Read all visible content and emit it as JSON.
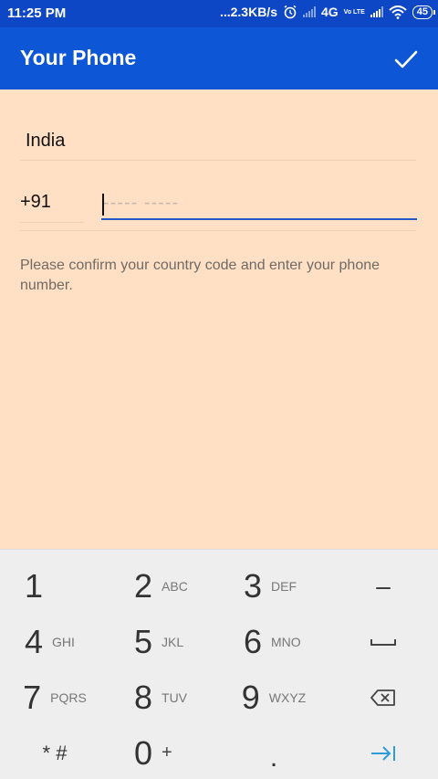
{
  "status_bar": {
    "time": "11:25 PM",
    "speed": "...2.3KB/s",
    "network": "4G",
    "volte": "Vo LTE",
    "battery": "45"
  },
  "app_bar": {
    "title": "Your Phone"
  },
  "form": {
    "country": "India",
    "country_code": "+91",
    "phone_placeholder": "----- -----",
    "hint": "Please confirm your country code and enter your phone number."
  },
  "keypad": {
    "keys": [
      {
        "num": "1",
        "letters": ""
      },
      {
        "num": "2",
        "letters": "ABC"
      },
      {
        "num": "3",
        "letters": "DEF"
      },
      {
        "num": "4",
        "letters": "GHI"
      },
      {
        "num": "5",
        "letters": "JKL"
      },
      {
        "num": "6",
        "letters": "MNO"
      },
      {
        "num": "7",
        "letters": "PQRS"
      },
      {
        "num": "8",
        "letters": "TUV"
      },
      {
        "num": "9",
        "letters": "WXYZ"
      },
      {
        "num": "0",
        "letters": "+"
      }
    ],
    "minus": "–",
    "star_hash": "* #",
    "dot": "."
  },
  "colors": {
    "app_bar": "#0d57d6",
    "background": "#ffe0c4",
    "accent": "#2557c8",
    "next_arrow": "#2f9cd8"
  }
}
